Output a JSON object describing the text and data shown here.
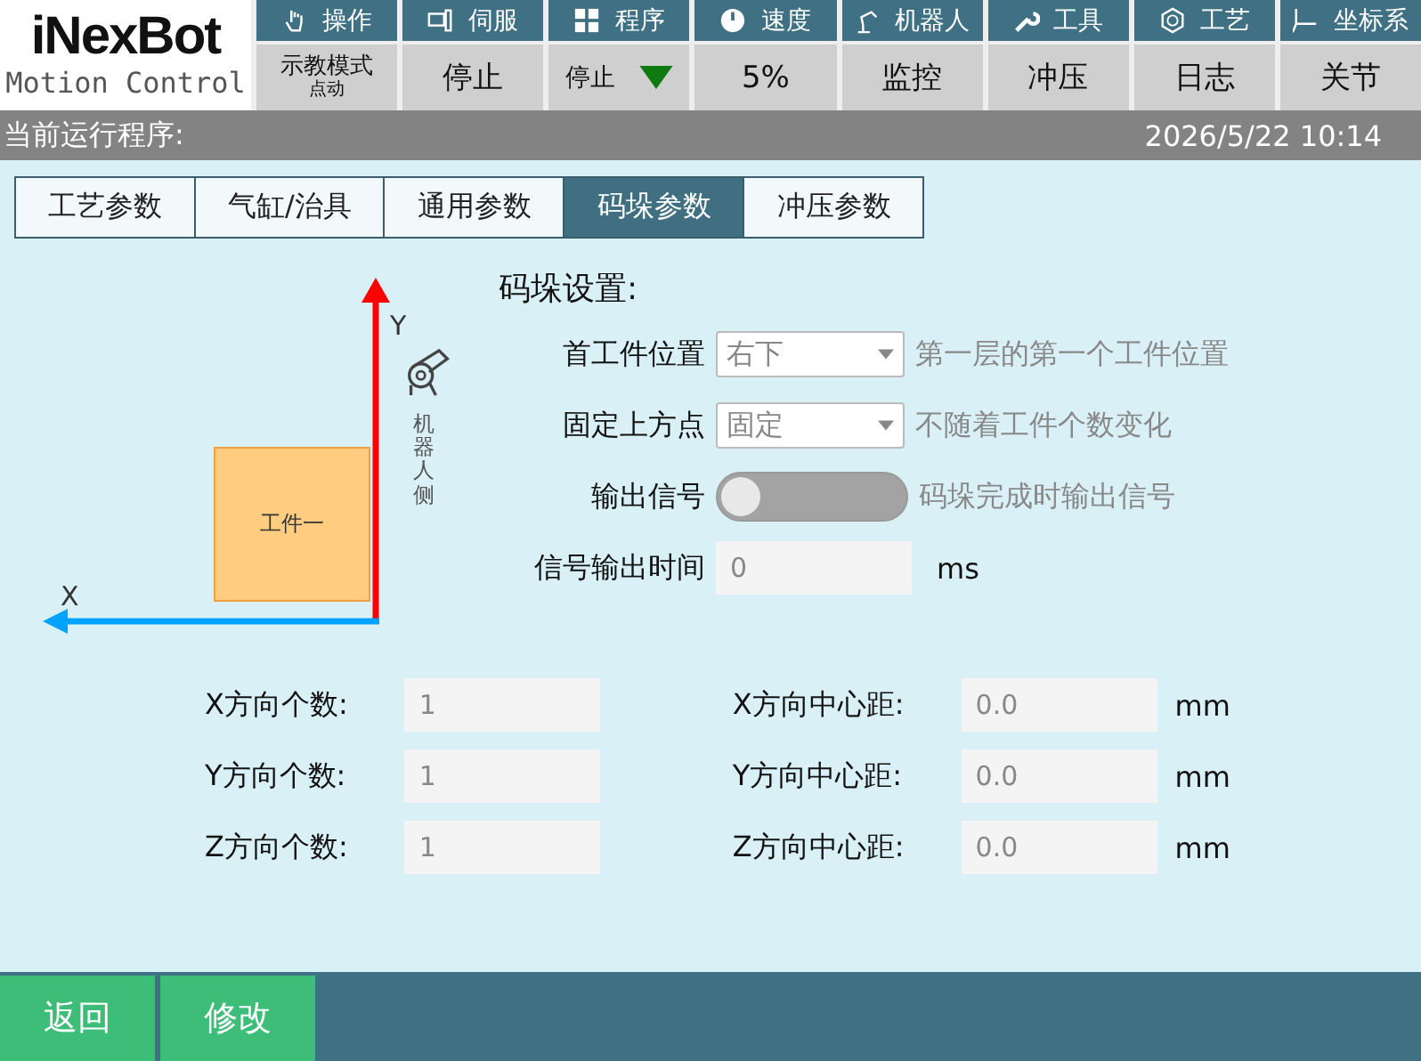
{
  "logo": {
    "brand": "iNexBot",
    "subtitle": "Motion Control"
  },
  "menu": [
    {
      "label": "操作"
    },
    {
      "label": "伺服"
    },
    {
      "label": "程序"
    },
    {
      "label": "速度"
    },
    {
      "label": "机器人"
    },
    {
      "label": "工具"
    },
    {
      "label": "工艺"
    },
    {
      "label": "坐标系"
    }
  ],
  "status": {
    "mode": "示教模式",
    "submode": "点动",
    "cells": [
      {
        "label": "停止",
        "kind": "button"
      },
      {
        "label": "停止",
        "kind": "dropdown"
      },
      {
        "label": "5%",
        "kind": "button"
      },
      {
        "label": "监控",
        "kind": "button"
      },
      {
        "label": "冲压",
        "kind": "button"
      },
      {
        "label": "日志",
        "kind": "button"
      },
      {
        "label": "关节",
        "kind": "button"
      }
    ]
  },
  "info_bar": {
    "program_label": "当前运行程序:",
    "datetime": "2026/5/22 10:14"
  },
  "tabs": [
    {
      "label": "工艺参数",
      "selected": false
    },
    {
      "label": "气缸/治具",
      "selected": false
    },
    {
      "label": "通用参数",
      "selected": false
    },
    {
      "label": "码垛参数",
      "selected": true
    },
    {
      "label": "冲压参数",
      "selected": false
    }
  ],
  "diagram": {
    "y_axis": "Y",
    "x_axis": "X",
    "workpiece": "工件一",
    "robot_side": "机器人侧"
  },
  "settings": {
    "title": "码垛设置:",
    "rows": [
      {
        "kind": "select",
        "label": "首工件位置",
        "value": "右下",
        "hint": "第一层的第一个工件位置"
      },
      {
        "kind": "select",
        "label": "固定上方点",
        "value": "固定",
        "hint": "不随着工件个数变化"
      },
      {
        "kind": "toggle",
        "label": "输出信号",
        "on": false,
        "hint": "码垛完成时输出信号"
      },
      {
        "kind": "input",
        "label": "信号输出时间",
        "value": "0",
        "unit": "ms"
      }
    ]
  },
  "counts": [
    {
      "label": "X方向个数:",
      "value": "1",
      "distance_label": "X方向中心距:",
      "distance": "0.0",
      "unit": "mm"
    },
    {
      "label": "Y方向个数:",
      "value": "1",
      "distance_label": "Y方向中心距:",
      "distance": "0.0",
      "unit": "mm"
    },
    {
      "label": "Z方向个数:",
      "value": "1",
      "distance_label": "Z方向中心距:",
      "distance": "0.0",
      "unit": "mm"
    }
  ],
  "buttons": [
    "返回",
    "修改"
  ]
}
